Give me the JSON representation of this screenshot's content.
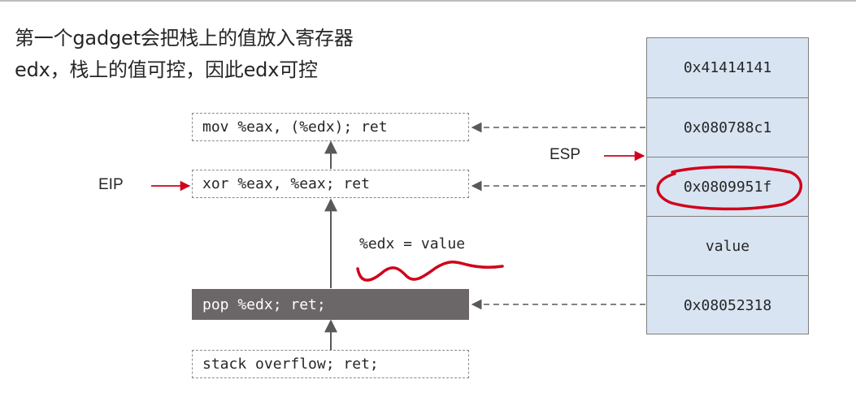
{
  "heading": {
    "line1": "第一个gadget会把栈上的值放入寄存器",
    "line2": "edx，栈上的值可控，因此edx可控"
  },
  "gadgets": [
    {
      "text": "mov %eax, (%edx); ret",
      "active": false
    },
    {
      "text": "xor %eax, %eax; ret",
      "active": false
    },
    {
      "text": "pop %edx; ret;",
      "active": true
    },
    {
      "text": "stack overflow; ret;",
      "active": false
    }
  ],
  "labels": {
    "eip": "EIP",
    "esp": "ESP",
    "edx_note": "%edx = value"
  },
  "stack": {
    "slots": [
      "0x41414141",
      "0x080788c1",
      "0x0809951f",
      "value",
      "0x08052318"
    ]
  },
  "colors": {
    "red": "#d0021b",
    "stack_fill": "#d9e4f2",
    "active_fill": "#6b6769"
  }
}
